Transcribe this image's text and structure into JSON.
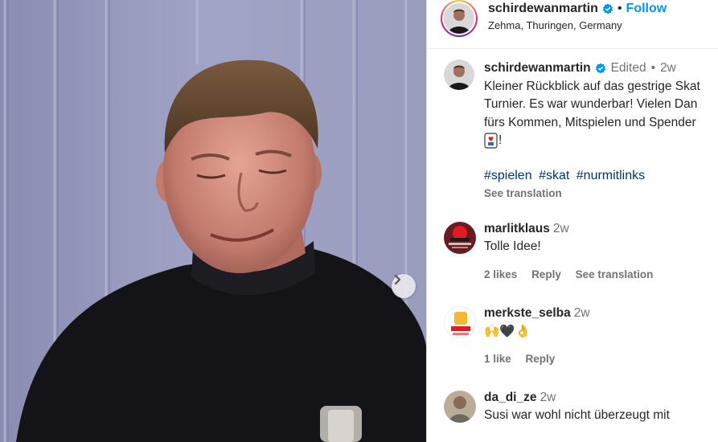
{
  "post": {
    "username": "schirdewanmartin",
    "follow_label": "Follow",
    "location": "Zehma, Thuringen, Germany"
  },
  "caption": {
    "username": "schirdewanmartin",
    "edited": "Edited",
    "age": "2w",
    "lines": [
      "Kleiner Rückblick auf das gestrige Skat",
      "Turnier. Es war wunderbar! Vielen Dan",
      "fürs Kommen, Mitspielen und Spender"
    ],
    "trailing": "!",
    "hashtags": [
      "#spielen",
      "#skat",
      "#nurmitlinks"
    ],
    "see_translation": "See translation"
  },
  "comments": [
    {
      "username": "marlitklaus",
      "age": "2w",
      "text": "Tolle Idee!",
      "likes": "2 likes",
      "reply": "Reply",
      "see_translation": "See translation"
    },
    {
      "username": "merkste_selba",
      "age": "2w",
      "text": "🙌🖤👌",
      "likes": "1 like",
      "reply": "Reply"
    },
    {
      "username": "da_di_ze",
      "age": "2w",
      "text": "Susi war wohl nicht überzeugt mit"
    }
  ],
  "colors": {
    "follow": "#0095f6",
    "hashtag": "#00376b",
    "verified": "#0095f6"
  },
  "icons": [
    "chevron-right-icon",
    "verified-badge-icon",
    "playing-card-emoji-icon"
  ]
}
